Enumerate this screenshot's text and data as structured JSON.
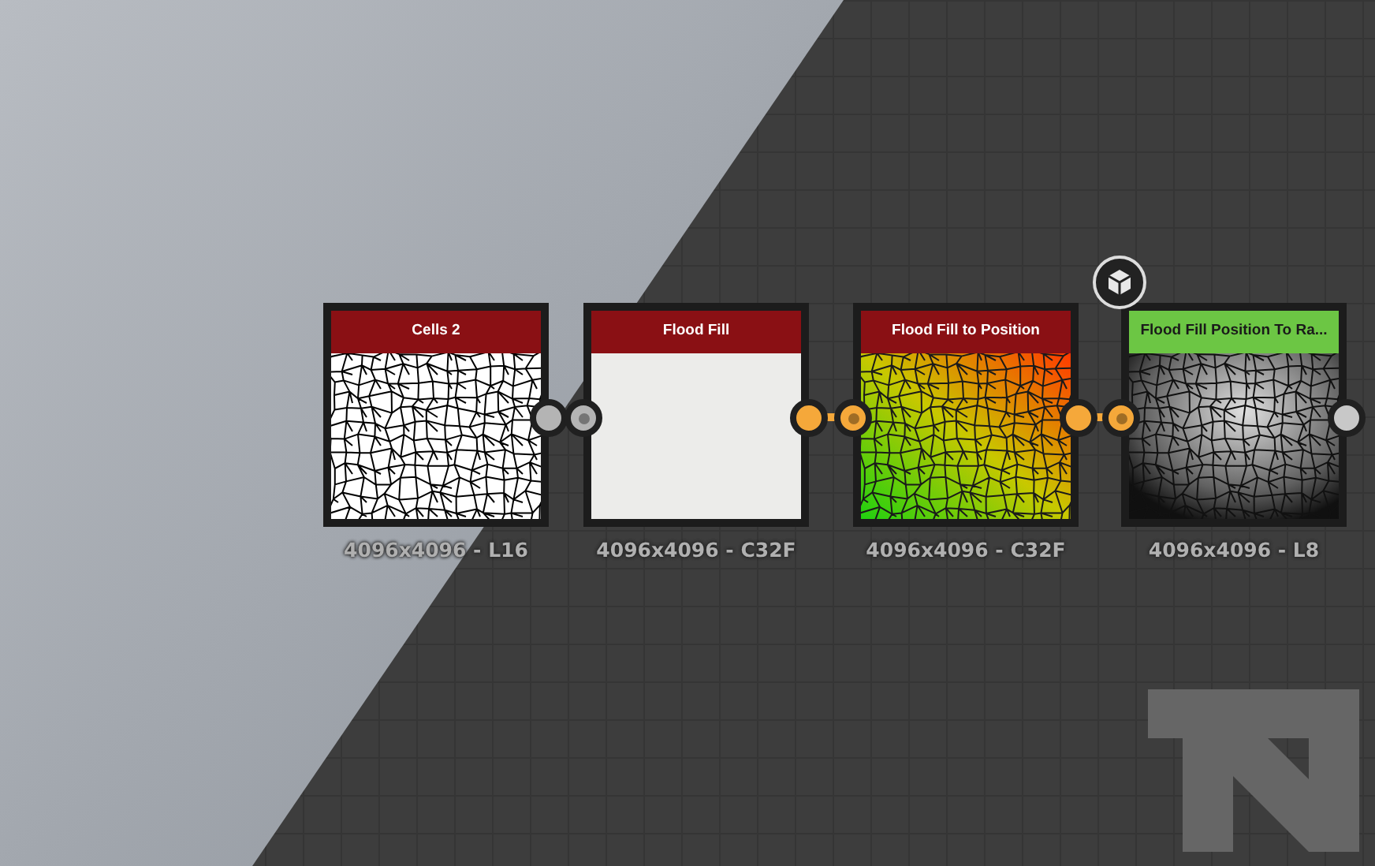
{
  "nodes": [
    {
      "title": "Cells 2",
      "color": "#8a1014",
      "caption": "4096x4096 - L16",
      "kind": "cells",
      "output_port": {
        "color": "#b4b4b4"
      }
    },
    {
      "title": "Flood Fill",
      "color": "#8a1014",
      "caption": "4096x4096 - C32F",
      "kind": "flat",
      "input_port": {
        "color": "#b4b4b4"
      },
      "output_port": {
        "color": "#f5a83a"
      }
    },
    {
      "title": "Flood Fill to Position",
      "color": "#8a1014",
      "caption": "4096x4096 - C32F",
      "kind": "gradient",
      "input_port": {
        "color": "#f5a83a"
      },
      "output_port": {
        "color": "#f5a83a"
      }
    },
    {
      "title": "Flood Fill Position To Ra...",
      "color": "#6cc644",
      "caption": "4096x4096 - L8",
      "kind": "grayscale",
      "badge": true,
      "input_port": {
        "color": "#f5a83a"
      },
      "output_port": {
        "color": "#c8c8c8"
      }
    }
  ],
  "links": [
    {
      "color": "#b4b4b4"
    },
    {
      "color": "#f5a83a"
    },
    {
      "color": "#f5a83a"
    }
  ]
}
